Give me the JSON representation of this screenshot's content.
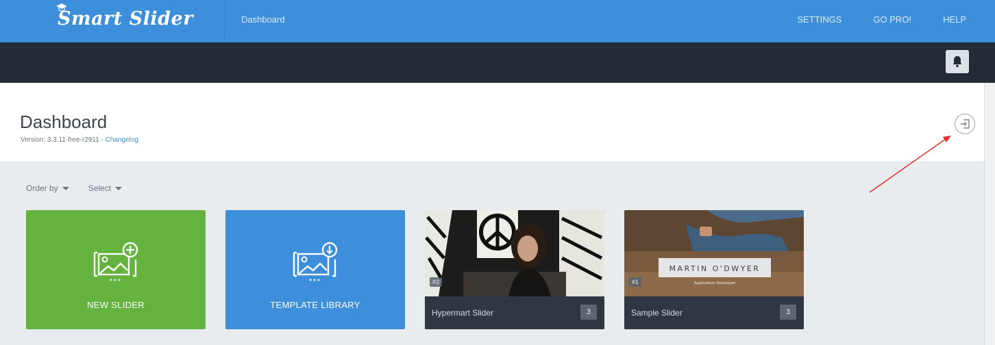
{
  "topbar": {
    "logo_text": "Smart Slider",
    "nav_label": "Dashboard",
    "links": [
      "SETTINGS",
      "GO PRO!",
      "HELP"
    ],
    "color": "#3e8fdb"
  },
  "subbar": {
    "color": "#232b36",
    "bell_icon": "bell-icon"
  },
  "header": {
    "title": "Dashboard",
    "version_text": "Version: 3.3.11-free-r2911 - ",
    "changelog_label": "Changelog",
    "exit_icon": "exit-icon"
  },
  "filters": {
    "order_by": "Order by",
    "select": "Select"
  },
  "tiles": {
    "new_slider": {
      "label": "NEW SLIDER",
      "color": "#63b33e",
      "icon": "image-plus-icon"
    },
    "template_library": {
      "label": "TEMPLATE LIBRARY",
      "color": "#3e8fdb",
      "icon": "image-download-icon"
    }
  },
  "sliders": [
    {
      "id": "#2",
      "name": "Hypermart Slider",
      "count": "3"
    },
    {
      "id": "#1",
      "name": "Sample Slider",
      "count": "3",
      "overlay_title": "MARTIN O'DWYER",
      "overlay_subtitle": "Application Developer"
    }
  ]
}
